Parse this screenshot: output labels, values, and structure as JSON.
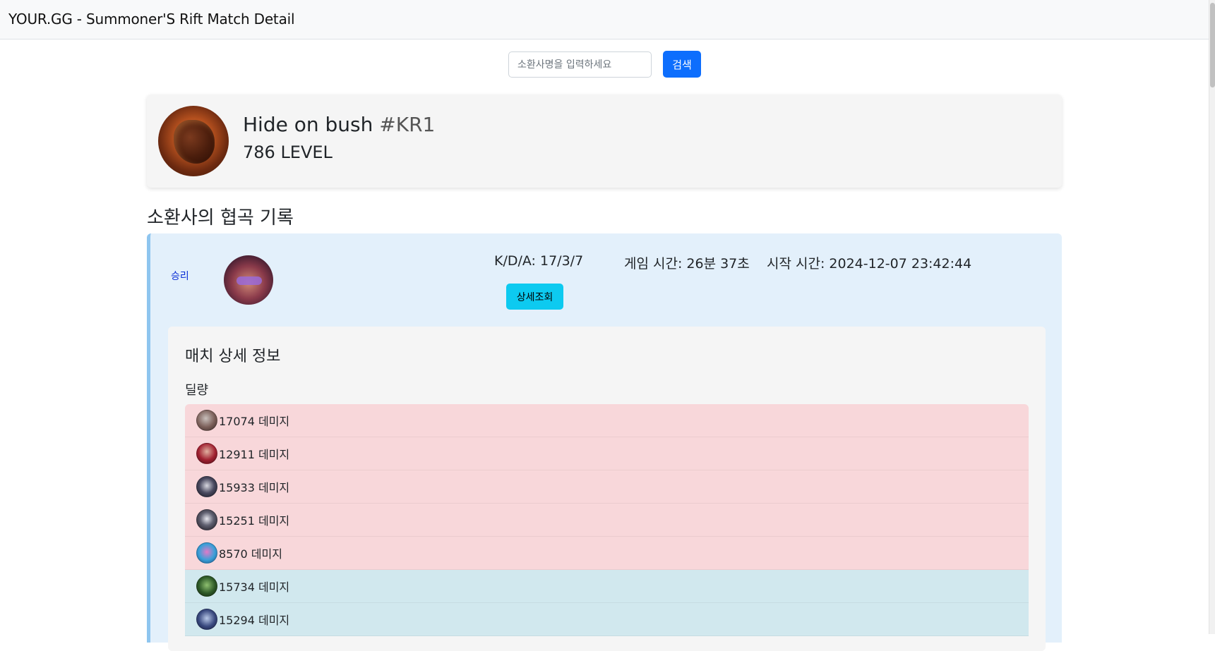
{
  "app": {
    "title": "YOUR.GG - Summoner'S Rift Match Detail"
  },
  "search": {
    "placeholder": "소환사명을 입력하세요",
    "button_label": "검색"
  },
  "profile": {
    "name": "Hide on bush",
    "tag": "#KR1",
    "level_text": "786 LEVEL"
  },
  "section": {
    "title": "소환사의 협곡 기록"
  },
  "match": {
    "result": "승리",
    "kda": "K/D/A: 17/3/7",
    "duration": "게임 시간: 26분 37초",
    "start_time": "시작 시간: 2024-12-07 23:42:44",
    "detail_button": "상세조회",
    "accent_color": "#8ec5ef",
    "result_color": "#0a2ed6"
  },
  "detail": {
    "title": "매치 상세 정보",
    "damage_label": "딜량",
    "rows": [
      {
        "text": "17074 데미지",
        "team": "red"
      },
      {
        "text": "12911 데미지",
        "team": "red"
      },
      {
        "text": "15933 데미지",
        "team": "red"
      },
      {
        "text": "15251 데미지",
        "team": "red"
      },
      {
        "text": "8570 데미지",
        "team": "red"
      },
      {
        "text": "15734 데미지",
        "team": "blue"
      },
      {
        "text": "15294 데미지",
        "team": "blue"
      }
    ]
  },
  "colors": {
    "primary_button": "#0d6efd",
    "info_button": "#0dcaf0",
    "red_team_row": "#f8d7da",
    "blue_team_row": "#d1e8ee"
  }
}
